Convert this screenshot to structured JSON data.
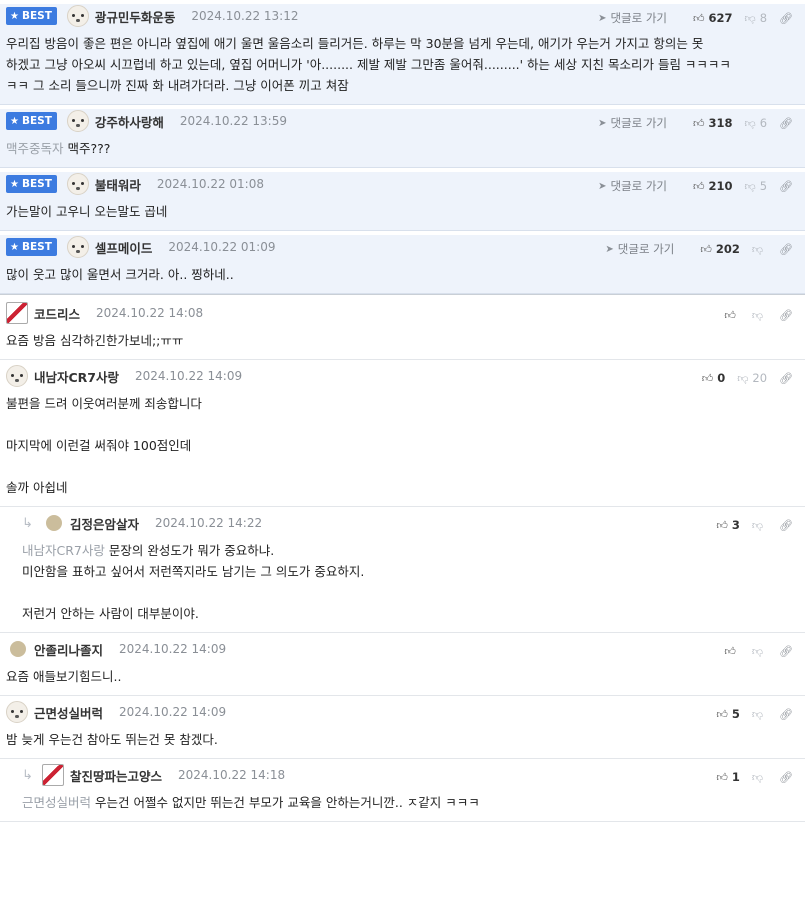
{
  "labels": {
    "best": "BEST",
    "goto": "댓글로 가기"
  },
  "comments": [
    {
      "best": true,
      "nick": "광규민두화운동",
      "date": "2024.10.22 13:12",
      "up": "627",
      "down": "8",
      "lines": [
        "우리집 방음이 좋은 편은 아니라 옆집에 애기 울면 울음소리 들리거든. 하루는 막 30분을 넘게 우는데, 애기가 우는거 가지고 항의는 못",
        "하겠고 그냥 아오씨 시끄럽네 하고 있는데, 옆집 어머니가 '아........ 제발 제발 그만좀 울어줘.........' 하는 세상 지친 목소리가 들림 ㅋㅋㅋㅋ",
        "ㅋㅋ 그 소리 들으니까 진짜 화 내려가더라. 그냥 이어폰 끼고 쳐잠"
      ]
    },
    {
      "best": true,
      "nick": "강주하사랑해",
      "date": "2024.10.22 13:59",
      "up": "318",
      "down": "6",
      "mention": "맥주중독자",
      "lines": [
        "맥주???"
      ]
    },
    {
      "best": true,
      "nick": "불태워라",
      "date": "2024.10.22 01:08",
      "up": "210",
      "down": "5",
      "lines": [
        "가는말이 고우니 오는말도 곱네"
      ]
    },
    {
      "best": true,
      "nick": "셀프메이드",
      "date": "2024.10.22 01:09",
      "up": "202",
      "down": "",
      "lines": [
        "많이 웃고 많이 울면서 크거라. 아.. 찡하네.."
      ]
    },
    {
      "nick": "코드리스",
      "date": "2024.10.22 14:08",
      "up": "",
      "down": "",
      "lines": [
        "요즘 방음 심각하긴한가보네;;ㅠㅠ"
      ]
    },
    {
      "nick": "내남자CR7사랑",
      "date": "2024.10.22 14:09",
      "up": "0",
      "down": "20",
      "lines": [
        "불편을 드려 이웃여러분께 죄송합니다",
        "",
        "마지막에 이런걸 써줘야 100점인데",
        "",
        "솔까 아쉽네"
      ]
    },
    {
      "reply": true,
      "nick": "김정은암살자",
      "date": "2024.10.22 14:22",
      "up": "3",
      "down": "",
      "mention": "내남자CR7사랑",
      "lines": [
        "문장의 완성도가 뭐가 중요하냐.",
        "미안함을 표하고 싶어서 저런쪽지라도 남기는 그 의도가 중요하지.",
        "",
        "저런거 안하는 사람이 대부분이야."
      ]
    },
    {
      "nick": "안졸리나졸지",
      "date": "2024.10.22 14:09",
      "up": "",
      "down": "",
      "lines": [
        "요즘 애들보기힘드니.."
      ]
    },
    {
      "nick": "근면성실버럭",
      "date": "2024.10.22 14:09",
      "up": "5",
      "down": "",
      "lines": [
        "밤 늦게 우는건 참아도 뛰는건 못 참겠다."
      ]
    },
    {
      "reply": true,
      "nick": "찰진땅파는고양스",
      "date": "2024.10.22 14:18",
      "up": "1",
      "down": "",
      "mention": "근면성실버럭",
      "lines": [
        "우는건 어쩔수 없지만 뛰는건 부모가 교육을 안하는거니깐.. ㅈ같지 ㅋㅋㅋ"
      ]
    }
  ]
}
